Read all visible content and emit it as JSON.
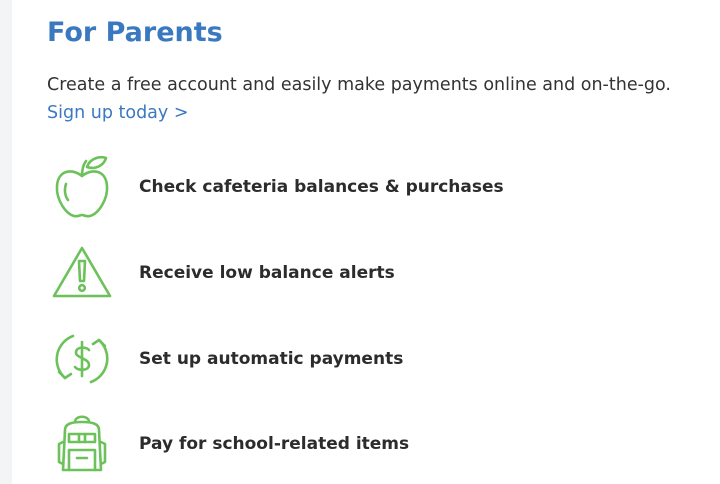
{
  "section": {
    "heading": "For Parents",
    "description": "Create a free account and easily make payments online and on-the-go.",
    "signup_link": "Sign up today >"
  },
  "features": [
    {
      "icon": "apple-icon",
      "label": "Check cafeteria balances & purchases"
    },
    {
      "icon": "warning-icon",
      "label": "Receive low balance alerts"
    },
    {
      "icon": "dollar-cycle-icon",
      "label": "Set up automatic payments"
    },
    {
      "icon": "backpack-icon",
      "label": "Pay for school-related items"
    }
  ],
  "colors": {
    "heading": "#3a78c0",
    "link": "#3a78c0",
    "icon": "#6cc15a",
    "text": "#2c2c2c"
  }
}
